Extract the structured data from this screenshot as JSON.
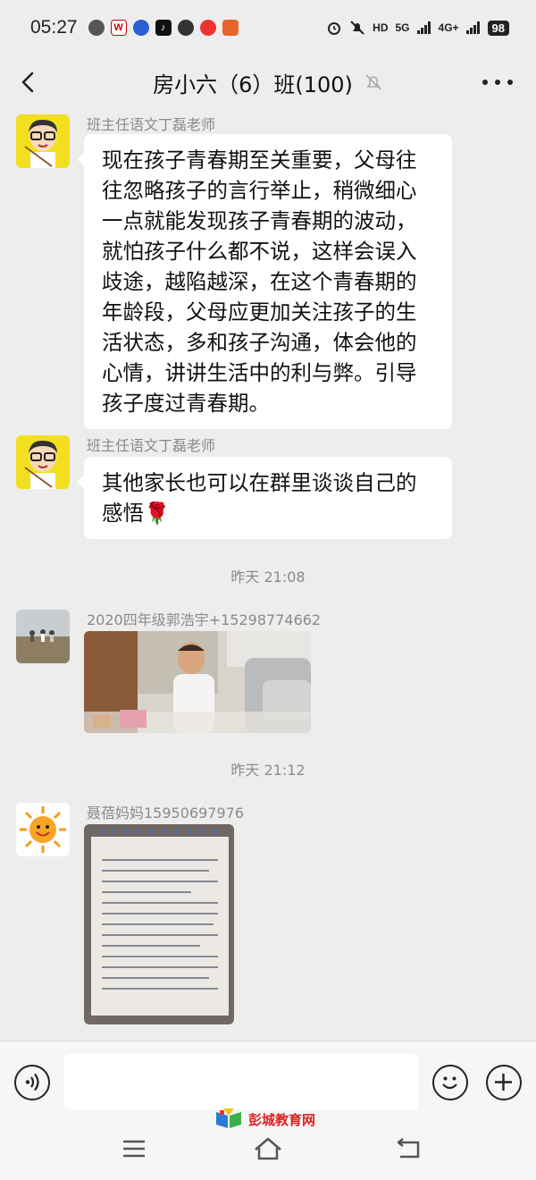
{
  "status_bar": {
    "time": "05:27",
    "signal_labels": [
      "HD",
      "5G",
      "4G+"
    ],
    "battery": "98"
  },
  "header": {
    "title": "房小六（6）班(100)",
    "muted": true
  },
  "messages": [
    {
      "sender": "班主任语文丁磊老师",
      "text": "现在孩子青春期至关重要，父母往往忽略孩子的言行举止，稍微细心一点就能发现孩子青春期的波动，就怕孩子什么都不说，这样会误入歧途，越陷越深，在这个青春期的年龄段，父母应更加关注孩子的生活状态，多和孩子沟通，体会他的心情，讲讲生活中的利与弊。引导孩子度过青春期。"
    },
    {
      "sender": "班主任语文丁磊老师",
      "text": "其他家长也可以在群里谈谈自己的感悟🌹"
    },
    {
      "timestamp": "昨天 21:08"
    },
    {
      "sender": "2020四年级郭浩宇+15298774662",
      "image": "photo of a man reading with a child on a sofa"
    },
    {
      "timestamp": "昨天 21:12"
    },
    {
      "sender": "聂蓓妈妈15950697976",
      "image": "photo of handwritten notes in a spiral notebook"
    }
  ],
  "input": {
    "placeholder": ""
  },
  "watermark": "彭城教育网",
  "colors": {
    "background": "#ededed",
    "bubble": "#ffffff",
    "meta_text": "#8a8a8a"
  }
}
